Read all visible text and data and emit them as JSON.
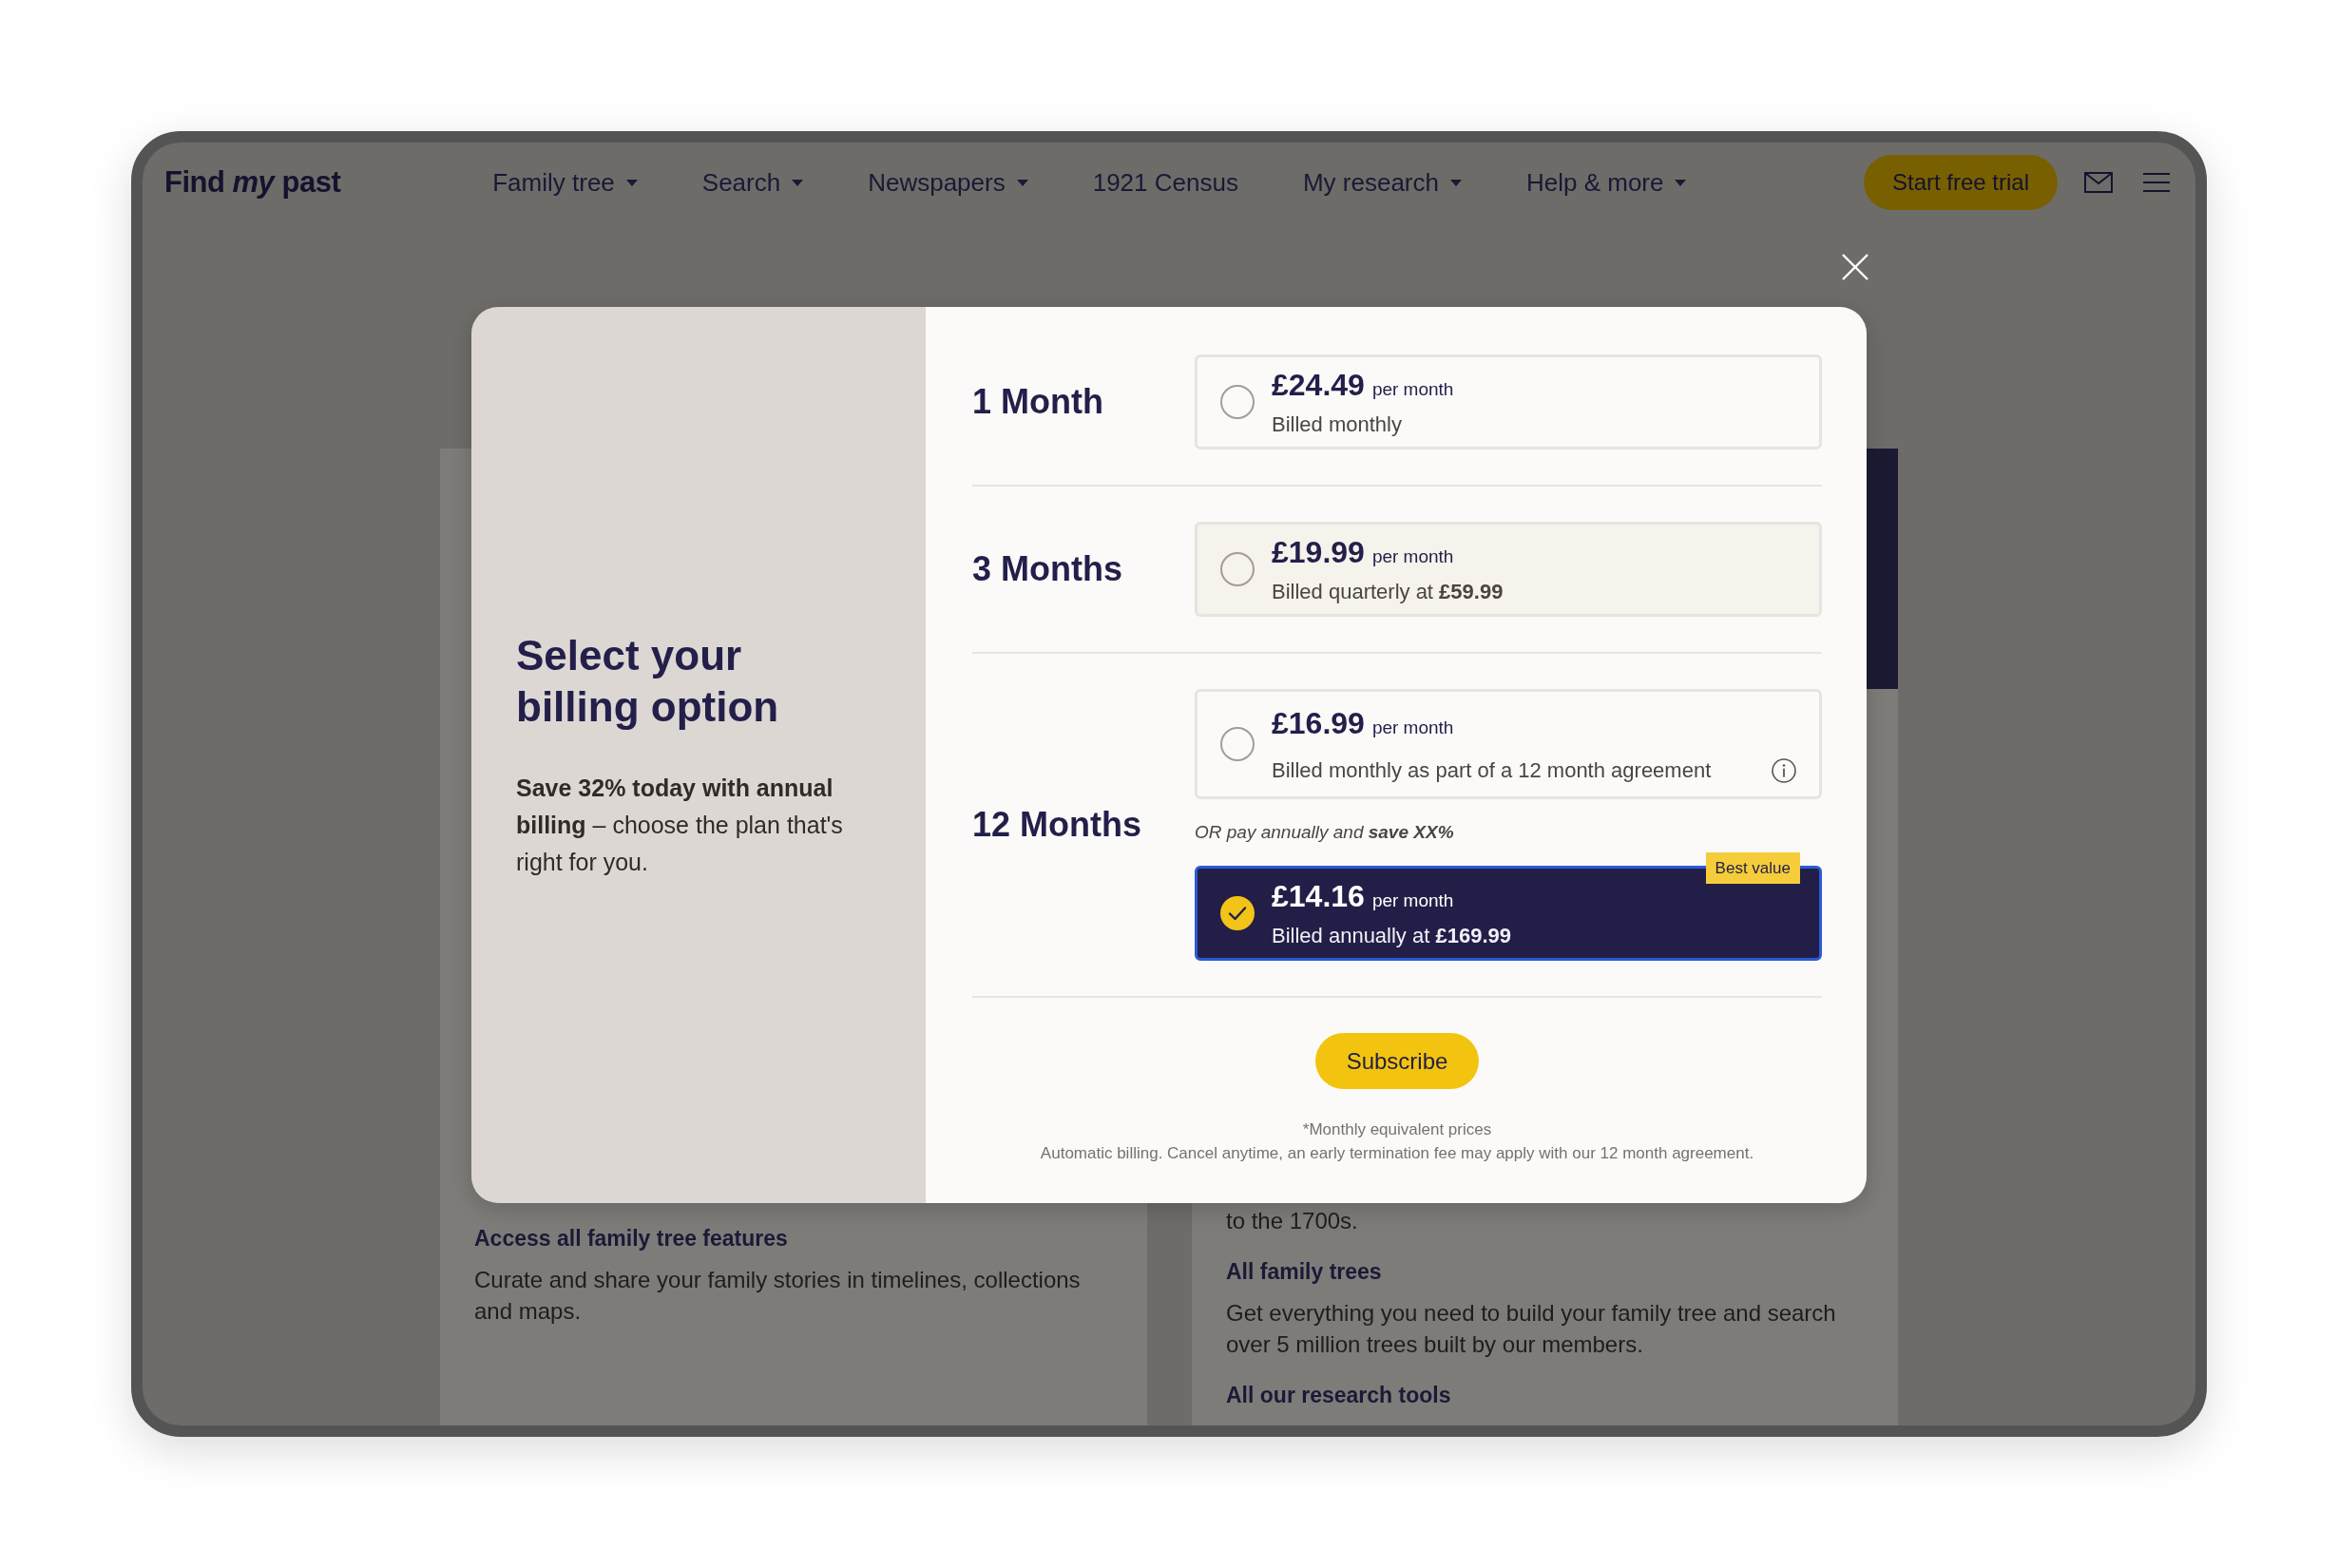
{
  "nav": {
    "logo": "Find *my* past",
    "items": [
      {
        "label": "Family tree",
        "menu": true
      },
      {
        "label": "Search",
        "menu": true
      },
      {
        "label": "Newspapers",
        "menu": true
      },
      {
        "label": "1921 Census",
        "menu": false
      },
      {
        "label": "My research",
        "menu": true
      },
      {
        "label": "Help & more",
        "menu": true
      }
    ],
    "cta": "Start free trial"
  },
  "page": {
    "left_column": {
      "blocks": [
        {
          "kind": "heading",
          "text": "Access all family tree features"
        },
        {
          "kind": "body",
          "text": "Curate and share your family stories in timelines, collections and maps."
        }
      ]
    },
    "right_column": {
      "blocks": [
        {
          "kind": "body",
          "text": "to the 1700s."
        },
        {
          "kind": "heading",
          "text": "All family trees"
        },
        {
          "kind": "body",
          "text": "Get everything you need to build your family tree and search over 5 million trees built by our members."
        },
        {
          "kind": "heading",
          "text": "All our research tools"
        }
      ]
    }
  },
  "modal": {
    "title": "Select your billing option",
    "intro": "**Save 32% today with annual billing** – choose the plan that's right for you.",
    "plans": [
      {
        "label": "1 Month",
        "items": [
          {
            "kind": "option",
            "price": "£24.49",
            "unit": "per month",
            "billing": "Billed monthly",
            "selected": false,
            "highlighted": false
          }
        ]
      },
      {
        "label": "3 Months",
        "items": [
          {
            "kind": "option",
            "price": "£19.99",
            "unit": "per month",
            "billing": "Billed quarterly at **£59.99**",
            "selected": false,
            "highlighted": true
          }
        ]
      },
      {
        "label": "12 Months",
        "items": [
          {
            "kind": "option",
            "price": "£16.99",
            "unit": "per month",
            "billing": "Billed monthly as part of a 12 month agreement",
            "info": true,
            "selected": false,
            "highlighted": false
          },
          {
            "kind": "note",
            "text": "OR pay annually and **save XX%**"
          },
          {
            "kind": "option",
            "price": "£14.16",
            "unit": "per month",
            "billing": "Billed annually at **£169.99**",
            "badge": "Best value",
            "selected": true,
            "highlighted": false
          }
        ]
      }
    ],
    "subscribe_button": "Subscribe",
    "footnotes": [
      "*Monthly equivalent prices",
      "Automatic billing. Cancel anytime, an early termination fee may apply with our 12 month agreement."
    ]
  }
}
